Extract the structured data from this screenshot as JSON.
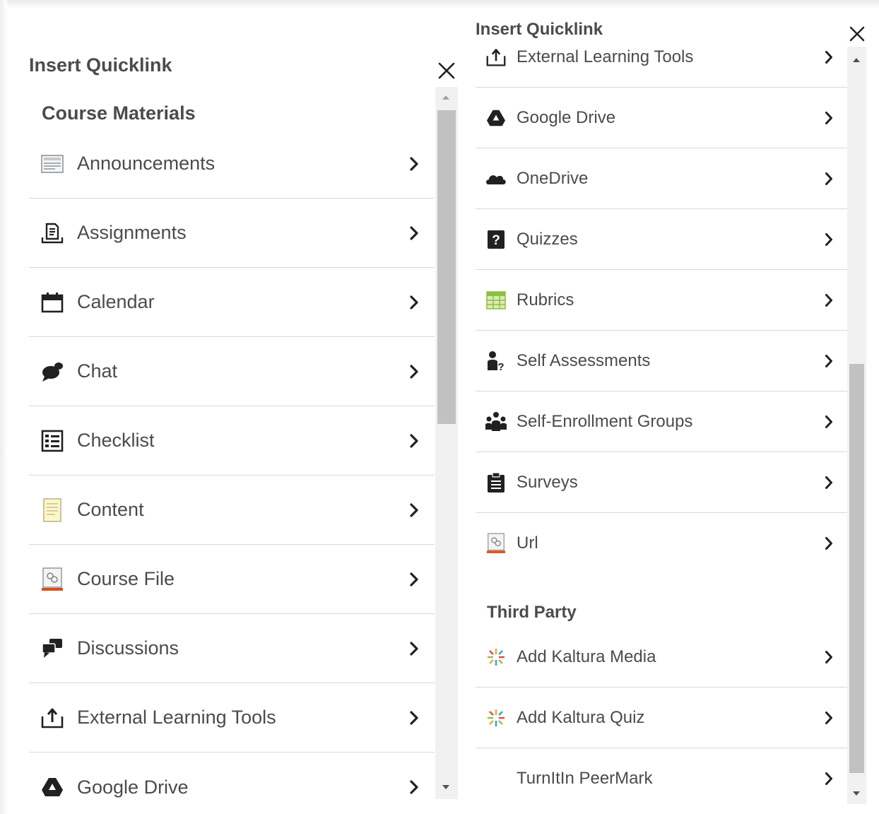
{
  "left_panel": {
    "title": "Insert Quicklink",
    "section_heading": "Course Materials",
    "items": [
      {
        "label": "Announcements",
        "icon": "announcements-icon"
      },
      {
        "label": "Assignments",
        "icon": "assignments-icon"
      },
      {
        "label": "Calendar",
        "icon": "calendar-icon"
      },
      {
        "label": "Chat",
        "icon": "chat-icon"
      },
      {
        "label": "Checklist",
        "icon": "checklist-icon"
      },
      {
        "label": "Content",
        "icon": "content-icon"
      },
      {
        "label": "Course File",
        "icon": "course-file-icon"
      },
      {
        "label": "Discussions",
        "icon": "discussions-icon"
      },
      {
        "label": "External Learning Tools",
        "icon": "external-tools-icon"
      },
      {
        "label": "Google Drive",
        "icon": "google-drive-icon"
      }
    ]
  },
  "right_panel": {
    "title": "Insert Quicklink",
    "items": [
      {
        "label": "External Learning Tools",
        "icon": "external-tools-icon"
      },
      {
        "label": "Google Drive",
        "icon": "google-drive-icon"
      },
      {
        "label": "OneDrive",
        "icon": "onedrive-icon"
      },
      {
        "label": "Quizzes",
        "icon": "quizzes-icon"
      },
      {
        "label": "Rubrics",
        "icon": "rubrics-icon"
      },
      {
        "label": "Self Assessments",
        "icon": "self-assessments-icon"
      },
      {
        "label": "Self-Enrollment Groups",
        "icon": "groups-icon"
      },
      {
        "label": "Surveys",
        "icon": "surveys-icon"
      },
      {
        "label": "Url",
        "icon": "url-icon"
      }
    ],
    "third_party_heading": "Third Party",
    "third_party_items": [
      {
        "label": "Add Kaltura Media",
        "icon": "kaltura-icon"
      },
      {
        "label": "Add Kaltura Quiz",
        "icon": "kaltura-icon"
      },
      {
        "label": "TurnItIn PeerMark",
        "icon": ""
      }
    ]
  },
  "colors": {
    "text": "#494c4e",
    "divider": "#d3d9e3",
    "scroll_thumb": "#c1c1c1",
    "file_accent": "#d8501a",
    "rubric_green": "#8cbf3f"
  }
}
